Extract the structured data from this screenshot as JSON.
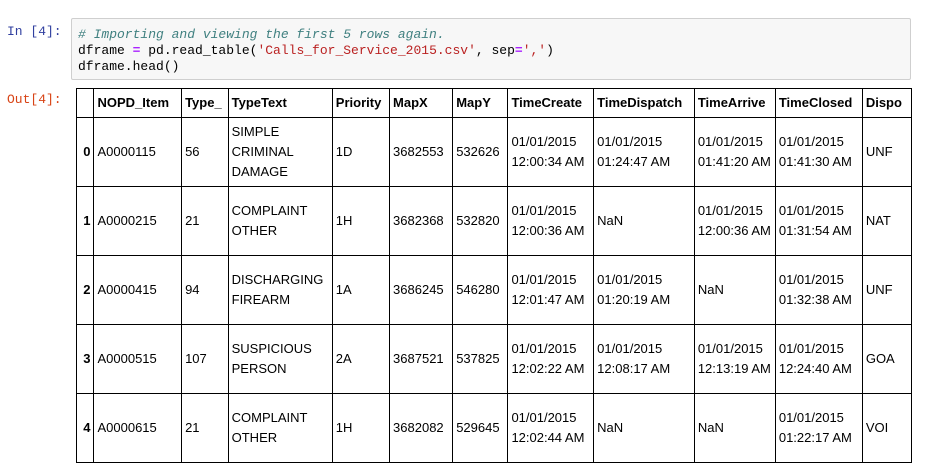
{
  "cell_in": {
    "prompt": "In [4]:",
    "code_comment": "# Importing and viewing the first 5 rows again.",
    "code_var": "dframe",
    "code_eq": " = ",
    "code_call_start": "pd.read_table(",
    "code_filename": "'Calls_for_Service_2015.csv'",
    "code_sep_part": ", sep",
    "code_sep_eq": "=",
    "code_sep_val": "','",
    "code_call_end": ")",
    "code_line3": "dframe.head()"
  },
  "cell_out": {
    "prompt": "Out[4]:",
    "columns": [
      "NOPD_Item",
      "Type_",
      "TypeText",
      "Priority",
      "MapX",
      "MapY",
      "TimeCreate",
      "TimeDispatch",
      "TimeArrive",
      "TimeClosed",
      "Dispo"
    ],
    "rows": [
      {
        "index": "0",
        "cells": [
          "A0000115",
          "56",
          "SIMPLE CRIMINAL DAMAGE",
          "1D",
          "3682553",
          "532626",
          "01/01/2015 12:00:34 AM",
          "01/01/2015 01:24:47 AM",
          "01/01/2015 01:41:20 AM",
          "01/01/2015 01:41:30 AM",
          "UNF"
        ]
      },
      {
        "index": "1",
        "cells": [
          "A0000215",
          "21",
          "COMPLAINT OTHER",
          "1H",
          "3682368",
          "532820",
          "01/01/2015 12:00:36 AM",
          "NaN",
          "01/01/2015 12:00:36 AM",
          "01/01/2015 01:31:54 AM",
          "NAT"
        ]
      },
      {
        "index": "2",
        "cells": [
          "A0000415",
          "94",
          "DISCHARGING FIREARM",
          "1A",
          "3686245",
          "546280",
          "01/01/2015 12:01:47 AM",
          "01/01/2015 01:20:19 AM",
          "NaN",
          "01/01/2015 01:32:38 AM",
          "UNF"
        ]
      },
      {
        "index": "3",
        "cells": [
          "A0000515",
          "107",
          "SUSPICIOUS PERSON",
          "2A",
          "3687521",
          "537825",
          "01/01/2015 12:02:22 AM",
          "01/01/2015 12:08:17 AM",
          "01/01/2015 12:13:19 AM",
          "01/01/2015 12:24:40 AM",
          "GOA"
        ]
      },
      {
        "index": "4",
        "cells": [
          "A0000615",
          "21",
          "COMPLAINT OTHER",
          "1H",
          "3682082",
          "529645",
          "01/01/2015 12:02:44 AM",
          "NaN",
          "NaN",
          "01/01/2015 01:22:17 AM",
          "VOI"
        ]
      }
    ]
  }
}
